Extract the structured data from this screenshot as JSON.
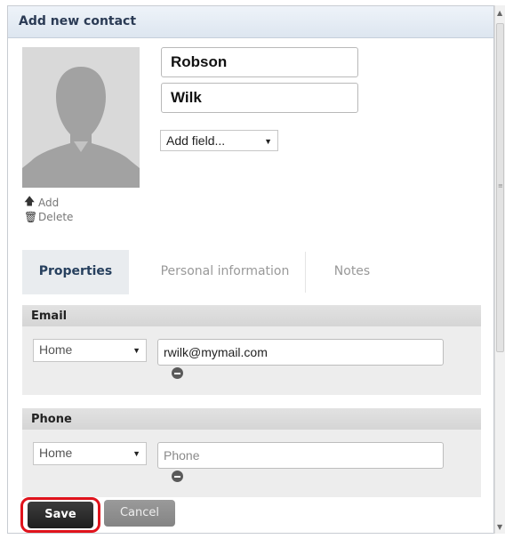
{
  "dialog": {
    "title": "Add new contact"
  },
  "photo": {
    "add_label": "Add",
    "delete_label": "Delete"
  },
  "name": {
    "first": "Robson",
    "last": "Wilk"
  },
  "add_field": {
    "selected": "Add field..."
  },
  "tabs": [
    {
      "label": "Properties",
      "active": true
    },
    {
      "label": "Personal information",
      "active": false
    },
    {
      "label": "Notes",
      "active": false
    }
  ],
  "email": {
    "heading": "Email",
    "type": "Home",
    "value": "rwilk@mymail.com"
  },
  "phone": {
    "heading": "Phone",
    "type": "Home",
    "placeholder": "Phone"
  },
  "buttons": {
    "save": "Save",
    "cancel": "Cancel"
  },
  "colors": {
    "highlight_ring": "#e0131c",
    "title_text": "#2b3b55"
  }
}
